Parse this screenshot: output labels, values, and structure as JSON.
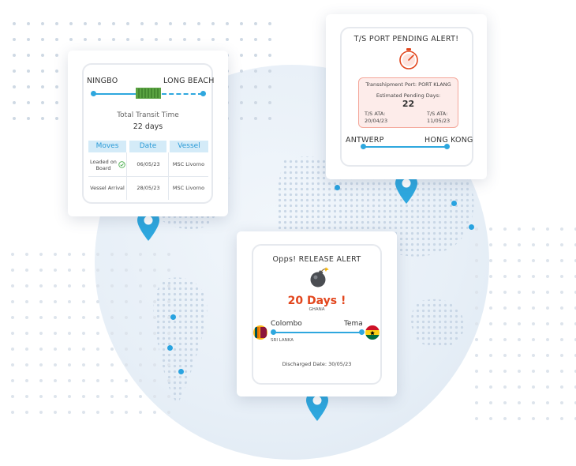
{
  "route_card": {
    "origin": "NINGBO",
    "destination": "LONG BEACH",
    "transit_label": "Total Transit Time",
    "transit_value": "22 days",
    "columns": [
      "Moves",
      "Date",
      "Vessel"
    ],
    "rows": [
      {
        "move": "Loaded on Board",
        "date": "06/05/23",
        "vessel": "MSC Livorno",
        "done": true
      },
      {
        "move": "Vessel Arrival",
        "date": "28/05/23",
        "vessel": "MSC Livorno",
        "done": false
      }
    ]
  },
  "ts_card": {
    "title": "T/S PORT PENDING ALERT!",
    "port_text": "Transshipment Port: PORT KLANG",
    "pending_label": "Estimated Pending Days:",
    "pending_value": "22",
    "ata1_label": "T/S ATA:",
    "ata1_date": "20/04/23",
    "ata2_label": "T/S ATA:",
    "ata2_date": "11/05/23",
    "origin": "ANTWERP",
    "destination": "HONG KONG"
  },
  "release_card": {
    "title": "Opps! RELEASE ALERT",
    "days": "20 Days !",
    "country_dest": "GHANA",
    "origin": "Colombo",
    "destination": "Tema",
    "country_origin": "SRI LANKA",
    "discharged": "Discharged Date: 30/05/23"
  },
  "colors": {
    "accent": "#2ea7de",
    "alert_red": "#e2461d",
    "alert_bg": "#fdecea"
  }
}
